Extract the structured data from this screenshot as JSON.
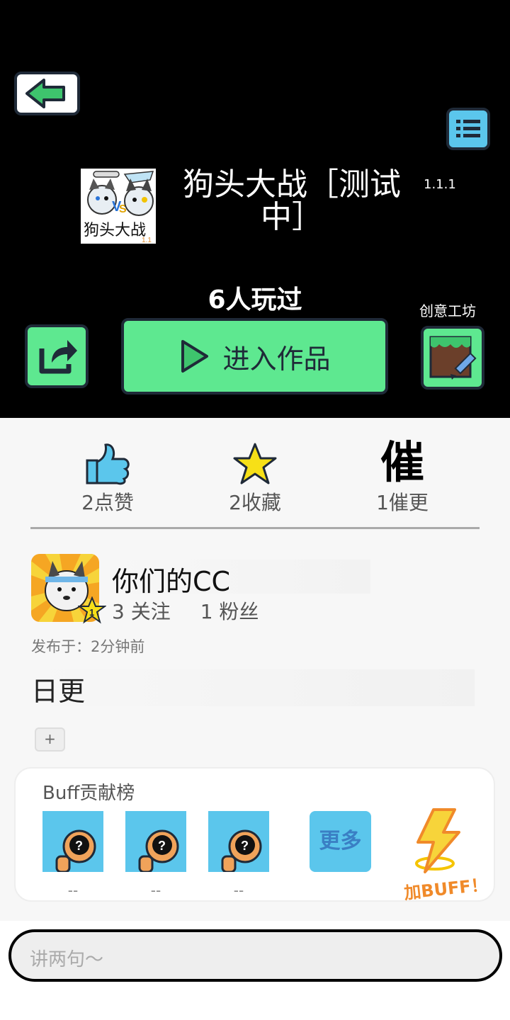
{
  "header": {
    "game_title": "狗头大战［测试中］",
    "version": "1.1.1",
    "thumb_text": "狗头大战",
    "thumb_version": "1.1",
    "players": "6人玩过",
    "workshop_label": "创意工坊",
    "play_label": "进入作品"
  },
  "stats": {
    "likes": "2点赞",
    "favorites": "2收藏",
    "urge_icon_text": "催",
    "urges": "1催更"
  },
  "author": {
    "name": "你们的CC",
    "level": "1",
    "following": "3 关注",
    "followers": "1 粉丝",
    "published": "发布于：2分钟前"
  },
  "post": {
    "text": "日更",
    "add_label": "+"
  },
  "buff": {
    "title": "Buff贡献榜",
    "contributors": [
      "--",
      "--",
      "--"
    ],
    "more_label": "更多",
    "add_buff_label": "加BUFF！"
  },
  "comment": {
    "placeholder": "讲两句～"
  },
  "colors": {
    "accent_green": "#5ee890",
    "accent_blue": "#5bc6ec",
    "buff_orange": "#f08a2a"
  }
}
